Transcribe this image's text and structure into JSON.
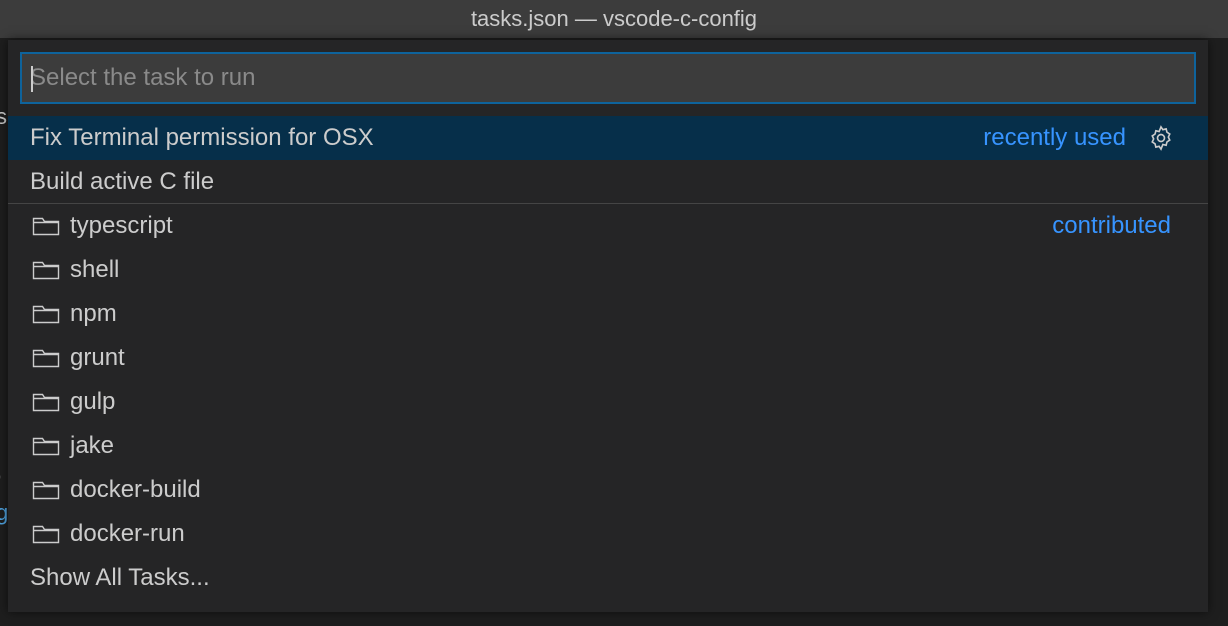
{
  "window": {
    "title": "tasks.json — vscode-c-config"
  },
  "background_fragments": {
    "f1": "s",
    "f2": ",",
    "f3": "g"
  },
  "quick_pick": {
    "input": {
      "value": "",
      "placeholder": "Select the task to run"
    },
    "recent": [
      {
        "label": "Fix Terminal permission for OSX",
        "detail": "recently used",
        "icon": "gear-icon",
        "selected": true
      },
      {
        "label": "Build active C file",
        "detail": ""
      }
    ],
    "contributed": [
      {
        "label": "typescript",
        "detail": "contributed",
        "icon": "folder-icon"
      },
      {
        "label": "shell",
        "icon": "folder-icon"
      },
      {
        "label": "npm",
        "icon": "folder-icon"
      },
      {
        "label": "grunt",
        "icon": "folder-icon"
      },
      {
        "label": "gulp",
        "icon": "folder-icon"
      },
      {
        "label": "jake",
        "icon": "folder-icon"
      },
      {
        "label": "docker-build",
        "icon": "folder-icon"
      },
      {
        "label": "docker-run",
        "icon": "folder-icon"
      }
    ],
    "show_all": {
      "label": "Show All Tasks..."
    }
  },
  "colors": {
    "accent": "#3794ff",
    "selection": "#062f4a",
    "input_border": "#0e639c",
    "panel_bg": "#252526",
    "titlebar_bg": "#3c3c3c"
  }
}
